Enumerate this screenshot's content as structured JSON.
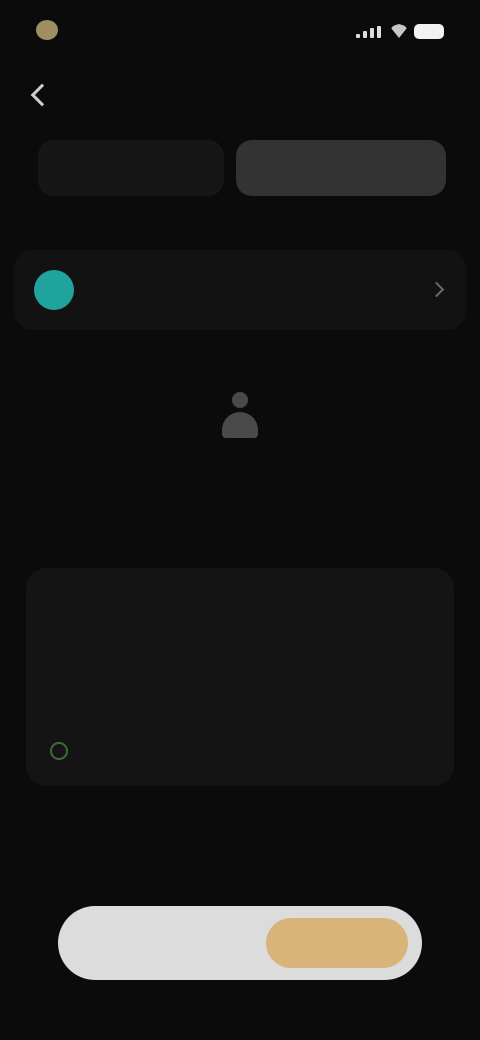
{
  "status_bar": {
    "time": ""
  },
  "tabs": {
    "left_label": "",
    "right_label": ""
  },
  "section": {
    "label": ""
  },
  "account": {
    "title": "",
    "subtitle": ""
  },
  "empty_state": {
    "title": ""
  },
  "info_card": {
    "text": "",
    "link_label": ""
  },
  "footer": {
    "note": ""
  },
  "actions": {
    "secondary_label": "",
    "primary_label": ""
  },
  "colors": {
    "background": "#0b0b0b",
    "avatar": "#1fa39c",
    "active_tab": "#333333",
    "action_bar": "#dcdcdc",
    "primary_action": "#d8b37a"
  },
  "icons": {
    "back": "chevron-left-icon",
    "account": "avatar-icon",
    "empty_state": "person-icon",
    "info_link": "circle-check-icon"
  }
}
